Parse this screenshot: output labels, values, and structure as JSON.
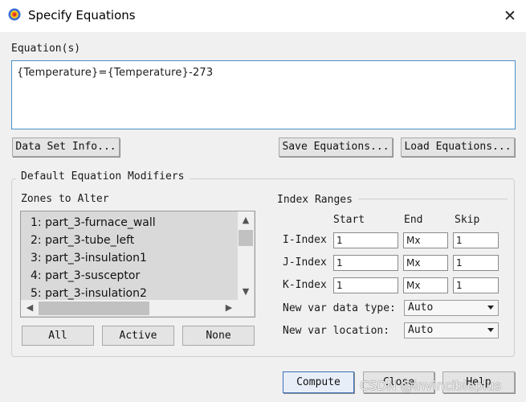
{
  "window": {
    "title": "Specify Equations",
    "close_glyph": "✕"
  },
  "equations": {
    "label": "Equation(s)",
    "value": "{Temperature}={Temperature}-273"
  },
  "buttons": {
    "data_set_info": "Data Set Info...",
    "save_equations": "Save Equations...",
    "load_equations": "Load Equations...",
    "all": "All",
    "active": "Active",
    "none": "None",
    "compute": "Compute",
    "close": "Close",
    "help": "Help"
  },
  "modifiers": {
    "group_label": "Default Equation Modifiers",
    "zones_label": "Zones to Alter",
    "zones": [
      "1: part_3-furnace_wall",
      "2: part_3-tube_left",
      "3: part_3-insulation1",
      "4: part_3-susceptor",
      "5: part_3-insulation2"
    ]
  },
  "index_ranges": {
    "label": "Index Ranges",
    "columns": [
      "Start",
      "End",
      "Skip"
    ],
    "rows": [
      {
        "label": "I-Index",
        "start": "1",
        "end": "Mx",
        "skip": "1"
      },
      {
        "label": "J-Index",
        "start": "1",
        "end": "Mx",
        "skip": "1"
      },
      {
        "label": "K-Index",
        "start": "1",
        "end": "Mx",
        "skip": "1"
      }
    ],
    "new_var_type_label": "New var data type:",
    "new_var_type_value": "Auto",
    "new_var_location_label": "New var location:",
    "new_var_location_value": "Auto"
  },
  "watermark": "CSDN @invincibleplus",
  "icons": {
    "app": "tecplot-app-icon",
    "close": "close-icon",
    "scroll_up": "▲",
    "scroll_down": "▼",
    "scroll_left": "◀",
    "scroll_right": "▶"
  },
  "colors": {
    "accent_border": "#4a90c8",
    "compute_border": "#3a6fb8"
  }
}
